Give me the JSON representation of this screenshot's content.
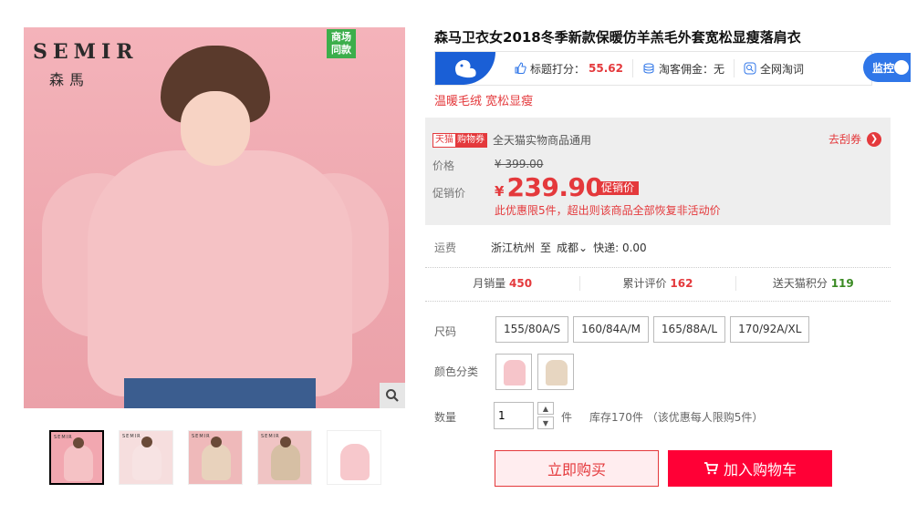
{
  "gallery": {
    "brand_latin": "SEMIR",
    "brand_cn": "森馬",
    "mall_badge": "商场同款",
    "zoom_icon": "magnifier-icon",
    "thumbnails": [
      {
        "logo": "SEMIR",
        "color": "#f5c2c5",
        "bg": "#f2a7b0"
      },
      {
        "logo": "SEMIR",
        "color": "#f7e3e3",
        "bg": "#f6dede"
      },
      {
        "logo": "SEMIR",
        "color": "#e8d2bc",
        "bg": "#efb9ba"
      },
      {
        "logo": "SEMIR",
        "color": "#d6bfa4",
        "bg": "#f0c4c4"
      },
      {
        "logo": "",
        "color": "#f7c8cc",
        "bg": "#ffffff"
      }
    ]
  },
  "product": {
    "title": "森马卫衣女2018冬季新款保暖仿羊羔毛外套宽松显瘦落肩衣",
    "tagline": "温暖毛绒 宽松显瘦"
  },
  "info_bar": {
    "logo_icon": "squirrel-icon",
    "score_label": "标题打分：",
    "score_value": "55.62",
    "commission_label": "淘客佣金：无",
    "search_label": "全网淘词",
    "monitor_label": "监控"
  },
  "price": {
    "coupon_tag_1": "天猫",
    "coupon_tag_2": "购物券",
    "coupon_text": "全天猫实物商品通用",
    "get_coupon": "去刮券",
    "price_label": "价格",
    "original": "¥ 399.00",
    "sale_label": "促销价",
    "currency": "¥",
    "sale_value": "239.90",
    "promo_tag": "促销价",
    "promo_note": "此优惠限5件，超出则该商品全部恢复非活动价"
  },
  "shipping": {
    "label": "运费",
    "origin": "浙江杭州",
    "to": "至",
    "dest": "成都",
    "fee": "快递: 0.00"
  },
  "stats": {
    "monthly_sales_label": "月销量",
    "monthly_sales": "450",
    "reviews_label": "累计评价",
    "reviews": "162",
    "points_label": "送天猫积分",
    "points": "119"
  },
  "options": {
    "size_label": "尺码",
    "sizes": [
      "155/80A/S",
      "160/84A/M",
      "165/88A/L",
      "170/92A/XL"
    ],
    "color_label": "颜色分类",
    "colors": [
      {
        "swatch": "#f6c5ca"
      },
      {
        "swatch": "#e7d6c1"
      }
    ],
    "qty_label": "数量",
    "qty_value": "1",
    "qty_unit": "件",
    "stock": "库存170件 （该优惠每人限购5件）"
  },
  "actions": {
    "buy_now": "立即购买",
    "add_cart": "加入购物车",
    "cart_icon": "cart-icon"
  }
}
